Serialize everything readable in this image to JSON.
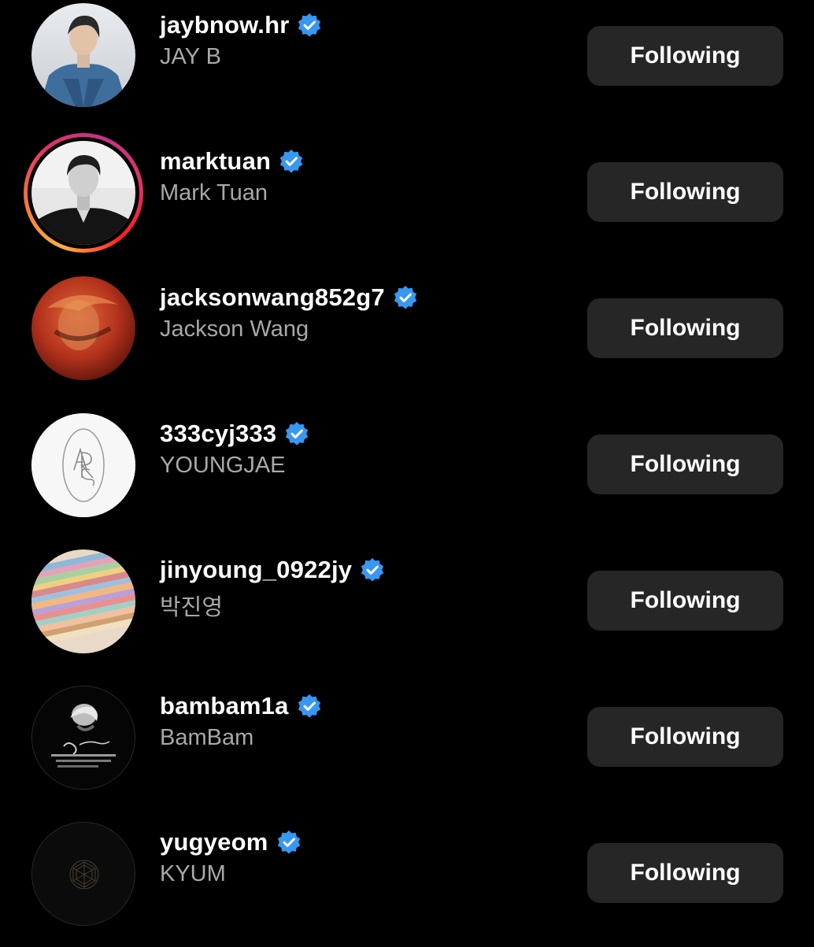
{
  "following_list": {
    "button_label": "Following",
    "verified_badge_color": "#3897f0",
    "follow_button_bg": "#262626",
    "secondary_text_color": "#a8a8a8",
    "accounts": [
      {
        "username": "jaybnow.hr",
        "full_name": "JAY B",
        "verified": true,
        "has_story": false,
        "avatar": "denim-jacket-portrait"
      },
      {
        "username": "marktuan",
        "full_name": "Mark Tuan",
        "verified": true,
        "has_story": true,
        "avatar": "black-and-white-portrait"
      },
      {
        "username": "jacksonwang852g7",
        "full_name": "Jackson Wang",
        "verified": true,
        "has_story": false,
        "avatar": "red-blurred-portrait"
      },
      {
        "username": "333cyj333",
        "full_name": "YOUNGJAE",
        "verified": true,
        "has_story": false,
        "avatar": "ars-monogram-logo"
      },
      {
        "username": "jinyoung_0922jy",
        "full_name": "박진영",
        "verified": true,
        "has_story": false,
        "avatar": "rainbow-striped-knit"
      },
      {
        "username": "bambam1a",
        "full_name": "BamBam",
        "verified": true,
        "has_story": false,
        "avatar": "dark-photo-with-script"
      },
      {
        "username": "yugyeom",
        "full_name": "KYUM",
        "verified": true,
        "has_story": false,
        "avatar": "dark-geometric-emblem"
      }
    ]
  }
}
